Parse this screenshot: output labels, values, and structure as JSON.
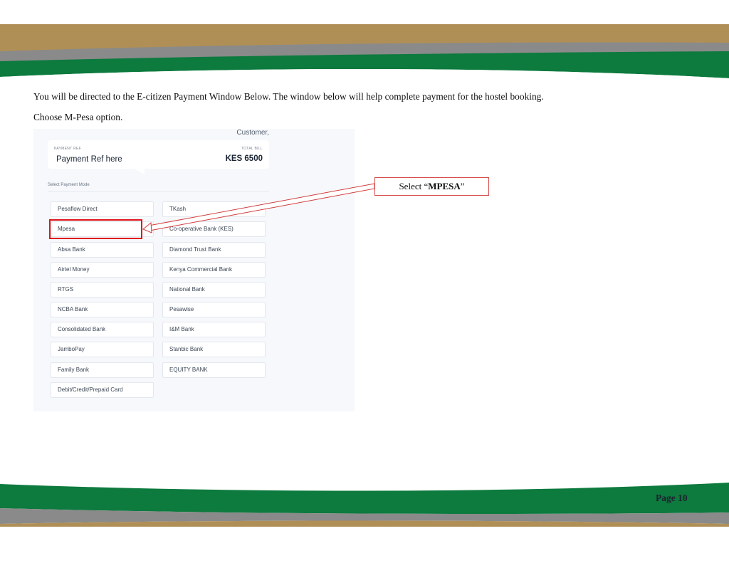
{
  "instructions": {
    "line1": "You will be directed to the E-citizen Payment Window Below. The window below will help complete payment for the hostel booking.",
    "line2": "Choose M-Pesa option."
  },
  "payment_window": {
    "customer_text": "Customer,",
    "payment_ref_label": "PAYMENT REF",
    "payment_ref_value": "Payment Ref here",
    "total_bill_label": "TOTAL BILL",
    "total_bill_value": "KES 6500",
    "select_mode_label": "Select Payment Mode",
    "options_left": [
      "Pesaflow Direct",
      "Mpesa",
      "Absa Bank",
      "Airtel Money",
      "RTGS",
      "NCBA Bank",
      "Consolidated Bank",
      "JamboPay",
      "Family Bank",
      "Debit/Credit/Prepaid Card"
    ],
    "options_right": [
      "TKash",
      "Co-operative Bank (KES)",
      "Diamond Trust Bank",
      "Kenya Commercial Bank",
      "National Bank",
      "Pesawise",
      "I&M Bank",
      "Stanbic Bank",
      "EQUITY BANK"
    ]
  },
  "callout": {
    "prefix": "Select “",
    "emphasis": "MPESA",
    "suffix": "”"
  },
  "footer": {
    "page": "Page 10"
  },
  "colors": {
    "band_gold": "#b08f56",
    "band_gray": "#8a8a8a",
    "band_green": "#0d7a3e",
    "highlight_red": "#e1141a"
  }
}
